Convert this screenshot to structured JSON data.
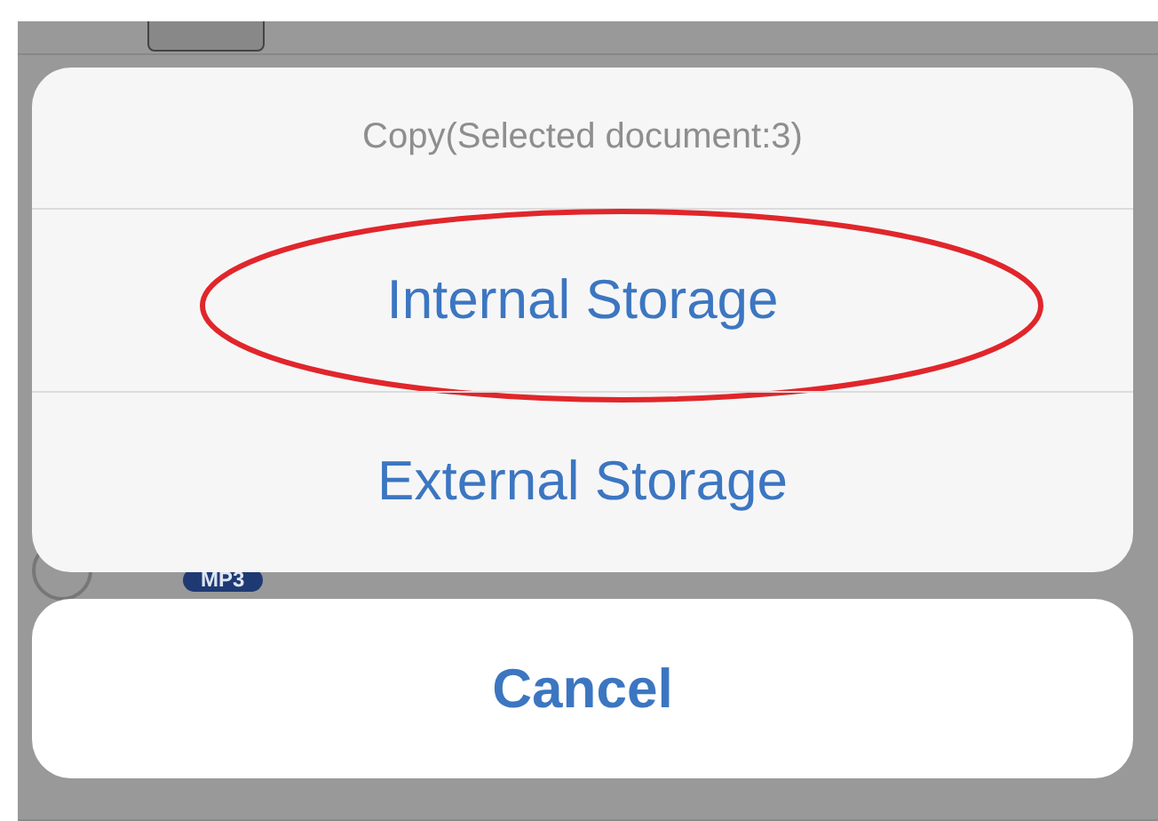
{
  "background_rows": [
    {
      "badge": "MP3"
    }
  ],
  "action_sheet": {
    "title": "Copy(Selected document:3)",
    "options": [
      {
        "label": "Internal Storage",
        "highlighted": true
      },
      {
        "label": "External Storage",
        "highlighted": false
      }
    ],
    "cancel": "Cancel"
  }
}
